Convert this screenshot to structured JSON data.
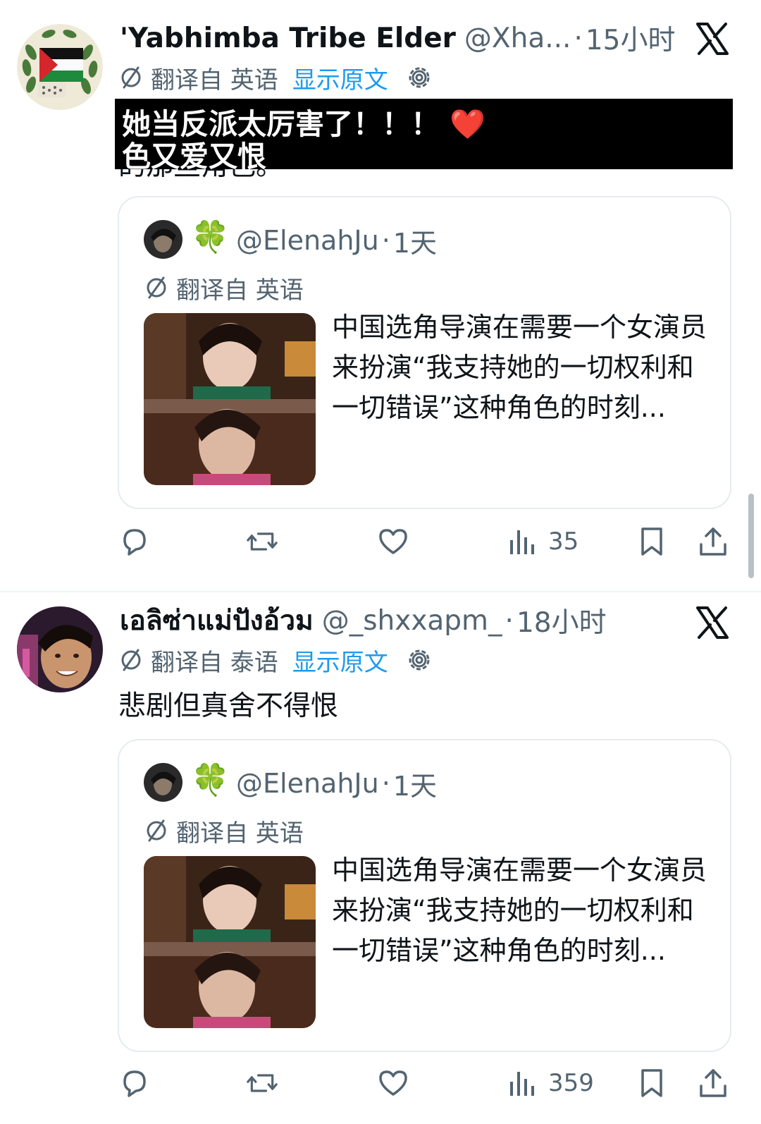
{
  "colors": {
    "link_blue": "#1d9bf0",
    "secondary_text": "#536471",
    "primary_text": "#0f1419",
    "border": "#e6ecef",
    "clover_green": "#2fb24c",
    "heart_red": "#e0245e"
  },
  "posts": [
    {
      "display_name": "'Yabhimba Tribe Elder",
      "handle": "@Xha...",
      "separator": "·",
      "time": "15小时",
      "avatar_icon": "palestine-flag-avatar",
      "close_icon": "x-logo-icon",
      "translate_from": "翻译自 英语",
      "show_original": "显示原文",
      "overlay_text_line1": "她当反派太厉害了！！！",
      "overlay_emoji": "❤️",
      "overlay_text_line2": "色又爱又恨",
      "clipped_text": "的那些角色。",
      "quote": {
        "clover": "🍀",
        "handle": "@ElenahJu",
        "separator": "·",
        "time": "1天",
        "translate_from": "翻译自 英语",
        "text": "中国选角导演在需要一个女演员来扮演“我支持她的一切权利和一切错误”这种角色的时刻..."
      },
      "actions": {
        "reply_icon": "reply-icon",
        "retweet_icon": "retweet-icon",
        "like_icon": "heart-icon",
        "views": "35",
        "bookmark_icon": "bookmark-icon",
        "share_icon": "share-icon"
      }
    },
    {
      "display_name": "เอลิซ่าแม่ปังอ้วม",
      "handle": "@_shxxapm_",
      "separator": "·",
      "time": "18小时",
      "avatar_icon": "user-avatar",
      "close_icon": "x-logo-icon",
      "translate_from": "翻译自 泰语",
      "show_original": "显示原文",
      "text": "悲剧但真舍不得恨",
      "quote": {
        "clover": "🍀",
        "handle": "@ElenahJu",
        "separator": "·",
        "time": "1天",
        "translate_from": "翻译自 英语",
        "text": "中国选角导演在需要一个女演员来扮演“我支持她的一切权利和一切错误”这种角色的时刻..."
      },
      "actions": {
        "reply_icon": "reply-icon",
        "retweet_icon": "retweet-icon",
        "like_icon": "heart-icon",
        "views": "359",
        "bookmark_icon": "bookmark-icon",
        "share_icon": "share-icon"
      }
    }
  ]
}
